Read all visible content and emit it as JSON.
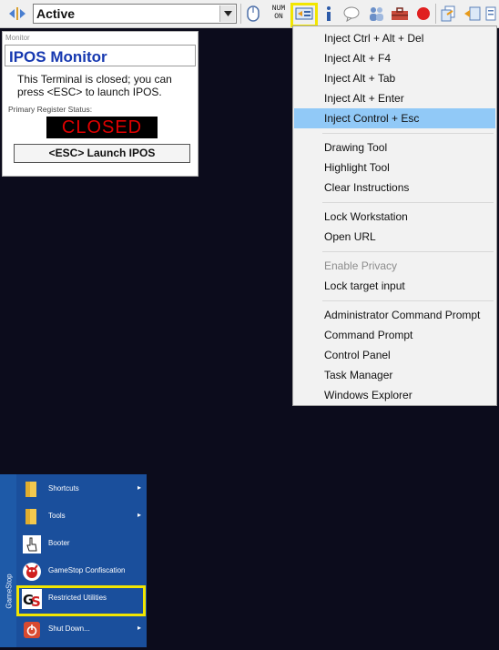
{
  "toolbar": {
    "status_value": "Active",
    "num_lock_line1": "NUM",
    "num_lock_line2": "ON",
    "icons": [
      "nav-arrows-icon",
      "mouse-icon",
      "inject-keys-icon",
      "info-icon",
      "chat-icon",
      "users-icon",
      "toolbox-icon",
      "stop-icon",
      "network-icon",
      "file-transfer-icon",
      "settings-icon"
    ],
    "highlight_color": "#f2e600"
  },
  "ipos": {
    "window_title": "Monitor",
    "heading": "IPOS Monitor",
    "message": "This Terminal is closed; you can press <ESC> to launch IPOS.",
    "register_status_label": "Primary Register Status:",
    "register_status": "CLOSED",
    "launch_button": "<ESC> Launch IPOS"
  },
  "context_menu": {
    "items": [
      {
        "label": "Inject Ctrl + Alt + Del",
        "state": "normal"
      },
      {
        "label": "Inject Alt + F4",
        "state": "normal"
      },
      {
        "label": "Inject Alt + Tab",
        "state": "normal"
      },
      {
        "label": "Inject Alt + Enter",
        "state": "normal"
      },
      {
        "label": "Inject Control + Esc",
        "state": "selected"
      },
      {
        "label": "Drawing Tool",
        "state": "normal"
      },
      {
        "label": "Highlight Tool",
        "state": "normal"
      },
      {
        "label": "Clear Instructions",
        "state": "normal"
      },
      {
        "label": "Lock Workstation",
        "state": "normal"
      },
      {
        "label": "Open URL",
        "state": "normal"
      },
      {
        "label": "Enable Privacy",
        "state": "disabled"
      },
      {
        "label": "Lock target input",
        "state": "normal"
      },
      {
        "label": "Administrator Command Prompt",
        "state": "normal"
      },
      {
        "label": "Command Prompt",
        "state": "normal"
      },
      {
        "label": "Control Panel",
        "state": "normal"
      },
      {
        "label": "Task Manager",
        "state": "normal"
      },
      {
        "label": "Windows Explorer",
        "state": "normal"
      }
    ]
  },
  "start_menu": {
    "side_label": "GameStop",
    "items": [
      {
        "label": "Shortcuts",
        "icon": "folder-icon",
        "has_submenu": true
      },
      {
        "label": "Tools",
        "icon": "folder-icon",
        "has_submenu": true
      },
      {
        "label": "Booter",
        "icon": "hand-pointer-icon",
        "has_submenu": false
      },
      {
        "label": "GameStop Confiscation",
        "icon": "confiscation-icon",
        "has_submenu": false
      },
      {
        "label": "Restricted Utilities",
        "icon": "gamestop-logo-icon",
        "has_submenu": false
      },
      {
        "label": "Shut Down...",
        "icon": "power-icon",
        "has_submenu": true
      }
    ],
    "submenu_arrow": "▸"
  }
}
